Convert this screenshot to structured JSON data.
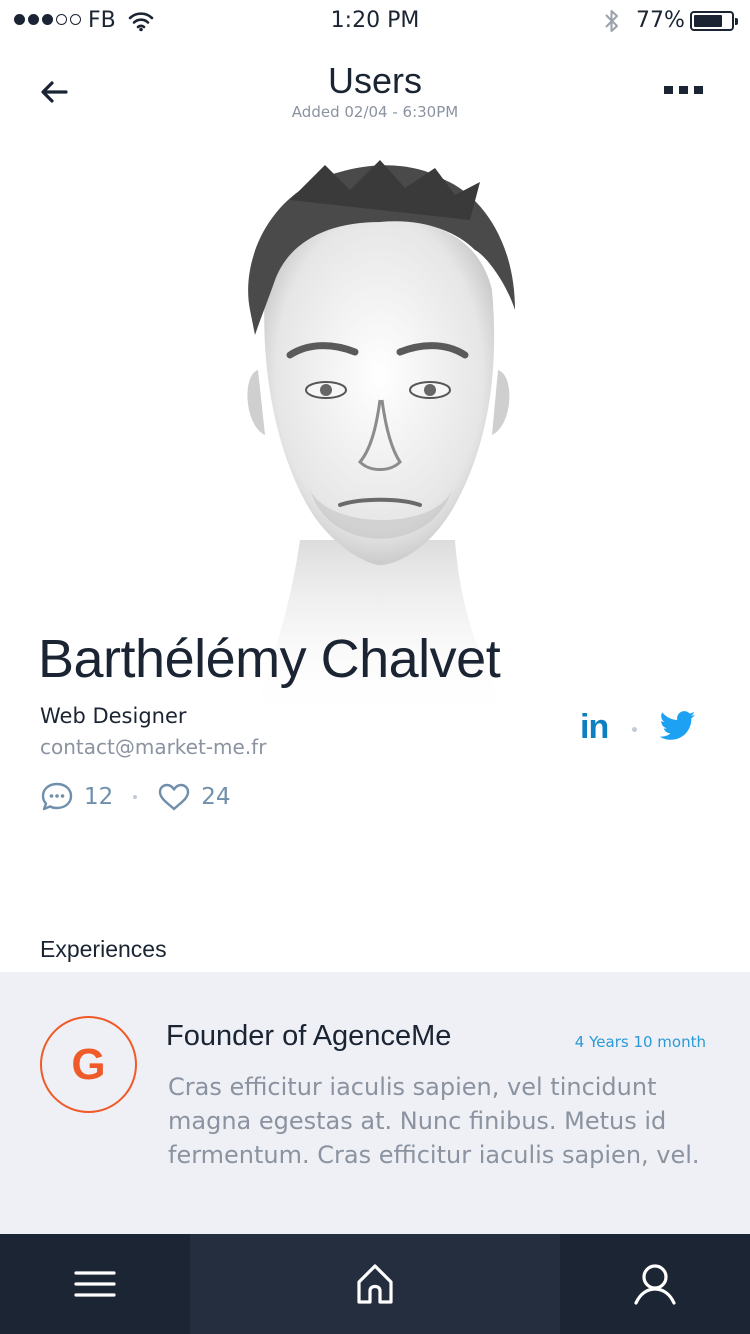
{
  "status_bar": {
    "carrier": "FB",
    "time": "1:20 PM",
    "battery_percent": "77%",
    "battery_level": 0.77,
    "signal_bars_filled": 3,
    "signal_bars_total": 5
  },
  "header": {
    "title": "Users",
    "subtitle": "Added 02/04 - 6:30PM"
  },
  "profile": {
    "name": "Barthélémy Chalvet",
    "role": "Web Designer",
    "email": "contact@market-me.fr",
    "comments_count": "12",
    "likes_count": "24",
    "social": {
      "linkedin_label": "in"
    }
  },
  "experiences": {
    "section_title": "Experiences",
    "items": [
      {
        "logo_letter": "G",
        "title": "Founder of AgenceMe",
        "duration": "4 Years 10 month",
        "description": "Cras efficitur iaculis sapien, vel tincidunt magna egestas at. Nunc finibus. Metus id fermentum. Cras efficitur iaculis sapien, vel."
      }
    ]
  },
  "colors": {
    "primary_text": "#1b2433",
    "muted_text": "#8b93a0",
    "accent_blue": "#2a9ad6",
    "linkedin_blue": "#0e7fbf",
    "twitter_blue": "#1da1f2",
    "company_orange": "#f05a28",
    "tab_bar": "#1c2533",
    "tab_active": "#242e3e",
    "card_bg": "#eef0f5"
  },
  "nav": {
    "icons": [
      "menu-icon",
      "home-icon",
      "user-search-icon"
    ],
    "active": "home"
  }
}
